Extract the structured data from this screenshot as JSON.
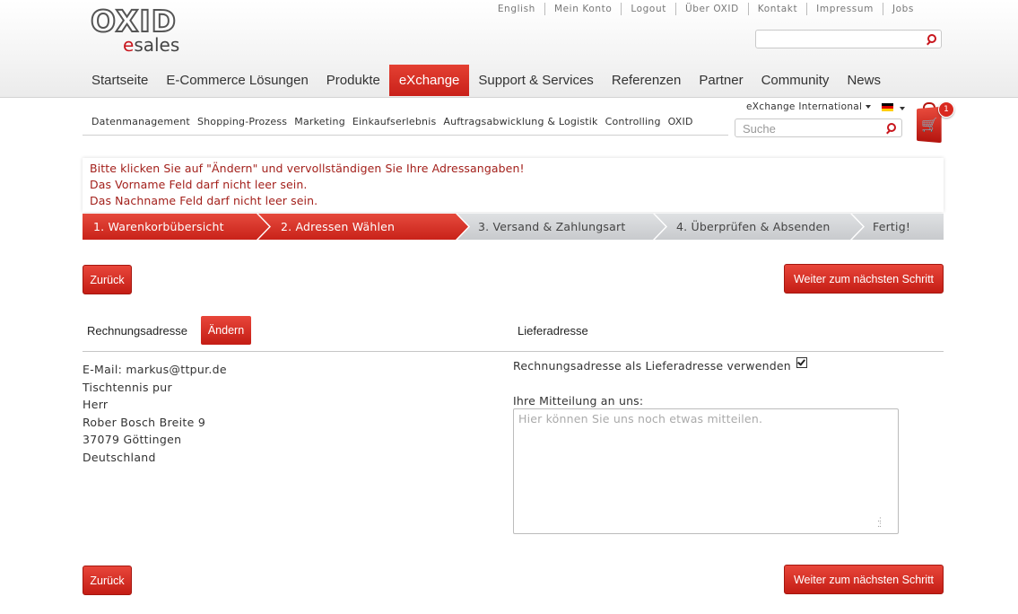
{
  "header": {
    "logo": {
      "main": "OXID",
      "sub_e": "e",
      "sub_rest": "sales"
    },
    "meta_links": [
      "English",
      "Mein Konto",
      "Logout",
      "Über OXID",
      "Kontakt",
      "Impressum",
      "Jobs"
    ],
    "search": {
      "placeholder": "",
      "icon": "search-icon"
    },
    "main_nav": [
      "Startseite",
      "E-Commerce Lösungen",
      "Produkte",
      "eXchange",
      "Support & Services",
      "Referenzen",
      "Partner",
      "Community",
      "News"
    ],
    "active_nav": "eXchange",
    "accent_color": "#d42b20"
  },
  "sub_nav": [
    "Datenmanagement",
    "Shopping-Prozess",
    "Marketing",
    "Einkaufserlebnis",
    "Auftragsabwicklung & Logistik",
    "Controlling",
    "OXID"
  ],
  "shop": {
    "region": "eXchange International",
    "language_flag": "de-flag-icon",
    "search_placeholder": "Suche",
    "cart_count": "1"
  },
  "errors": [
    "Bitte klicken Sie auf \"Ändern\" und vervollständigen Sie Ihre Adressangaben!",
    "Das Vorname Feld darf nicht leer sein.",
    "Das Nachname Feld darf nicht leer sein."
  ],
  "steps": [
    {
      "label": "1. Warenkorbübersicht",
      "state": "done"
    },
    {
      "label": "2. Adressen Wählen",
      "state": "done"
    },
    {
      "label": "3. Versand & Zahlungsart",
      "state": "todo"
    },
    {
      "label": "4. Überprüfen & Absenden",
      "state": "todo"
    },
    {
      "label": "Fertig!",
      "state": "todo"
    }
  ],
  "buttons": {
    "back": "Zurück",
    "next": "Weiter zum nächsten Schritt",
    "change": "Ändern"
  },
  "billing": {
    "heading": "Rechnungsadresse",
    "lines": [
      "E-Mail: markus@ttpur.de",
      "Tischtennis pur",
      "Herr",
      "Rober Bosch Breite 9",
      "37079 Göttingen",
      "Deutschland"
    ]
  },
  "shipping": {
    "heading": "Lieferadresse",
    "use_billing_label": "Rechnungsadresse als Lieferadresse verwenden",
    "use_billing_checked": true,
    "message_label": "Ihre Mitteilung an uns:",
    "message_placeholder": "Hier können Sie uns noch etwas mitteilen.",
    "message_value": ""
  }
}
